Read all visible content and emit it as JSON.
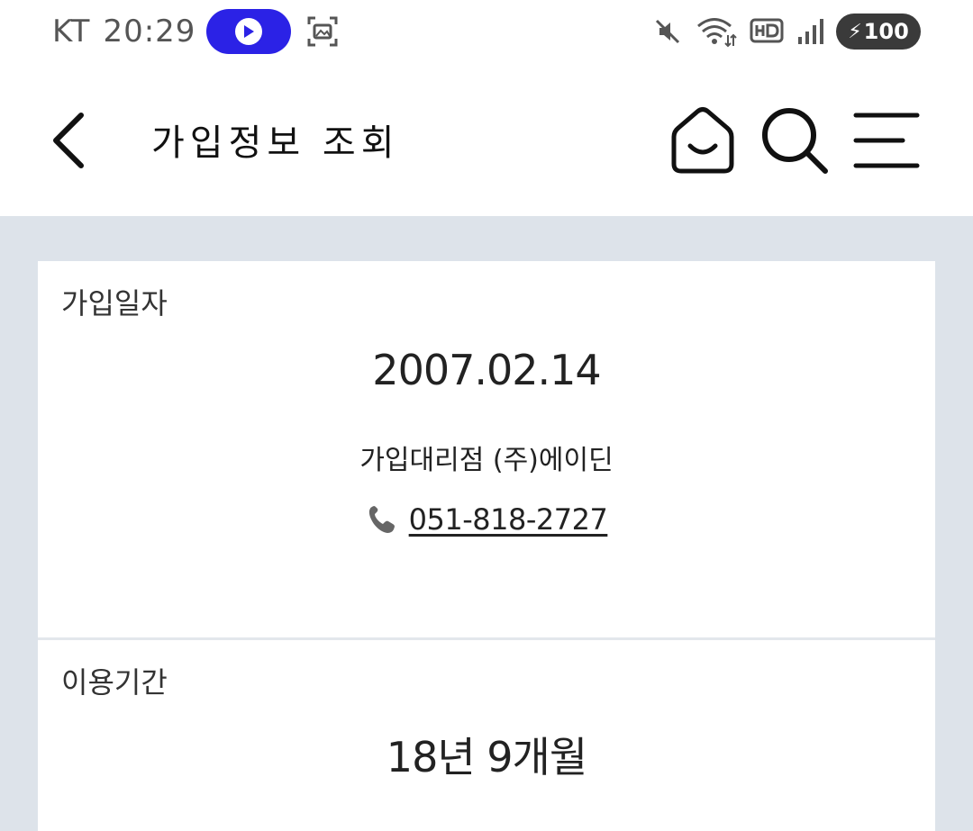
{
  "status_bar": {
    "carrier": "KT",
    "time": "20:29",
    "battery": "100",
    "icons": [
      "media-pill-icon",
      "screenshot-icon",
      "mute-icon",
      "wifi-icon",
      "hd-icon",
      "signal-icon",
      "battery-icon"
    ]
  },
  "header": {
    "title": "가입정보 조회",
    "icons": [
      "back-icon",
      "home-icon",
      "search-icon",
      "menu-icon"
    ]
  },
  "join_info": {
    "label": "가입일자",
    "date": "2007.02.14",
    "agency_label": "가입대리점",
    "agency_name": "(주)에이딘",
    "phone": "051-818-2727",
    "phone_icon": "phone-icon"
  },
  "usage_period": {
    "label": "이용기간",
    "value": "18년 9개월"
  },
  "colors": {
    "background": "#dde3ea",
    "card": "#ffffff",
    "pill": "#2b22e6",
    "text": "#222222"
  }
}
